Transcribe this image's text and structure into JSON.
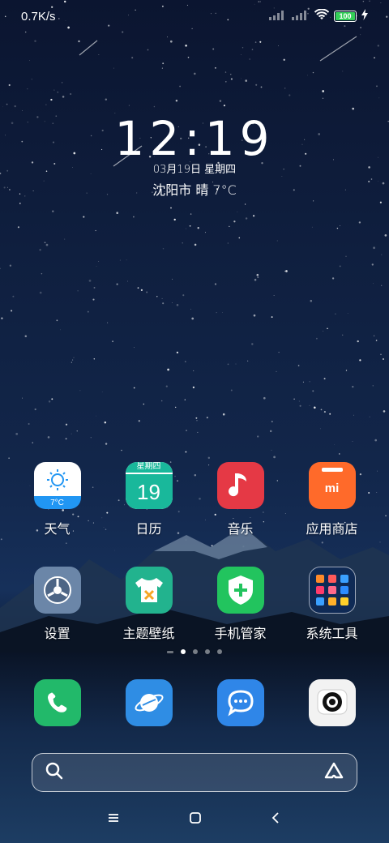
{
  "status_bar": {
    "network_speed": "0.7K/s",
    "battery_level": "100"
  },
  "clock": {
    "time": "12:19",
    "date": "03月19日 星期四",
    "weather": "沈阳市 晴 7°C"
  },
  "apps": {
    "row1": [
      {
        "label": "天气",
        "icon": "weather-icon",
        "sub": "7°C"
      },
      {
        "label": "日历",
        "icon": "calendar-icon",
        "weekday": "星期四",
        "day": "19"
      },
      {
        "label": "音乐",
        "icon": "music-icon"
      },
      {
        "label": "应用商店",
        "icon": "app-store-icon",
        "logo": "mi"
      }
    ],
    "row2": [
      {
        "label": "设置",
        "icon": "settings-icon"
      },
      {
        "label": "主题壁纸",
        "icon": "themes-icon"
      },
      {
        "label": "手机管家",
        "icon": "security-icon"
      },
      {
        "label": "系统工具",
        "icon": "tools-folder-icon"
      }
    ]
  },
  "page_indicator": {
    "pages": 4,
    "active": 1
  },
  "dock": [
    {
      "name": "phone",
      "icon": "phone-icon"
    },
    {
      "name": "browser",
      "icon": "browser-icon"
    },
    {
      "name": "messages",
      "icon": "messages-icon"
    },
    {
      "name": "camera",
      "icon": "camera-icon"
    }
  ],
  "search": {
    "placeholder": ""
  },
  "nav": {
    "menu": "menu-icon",
    "home": "home-icon",
    "back": "back-icon"
  },
  "colors": {
    "weather_top": "#ffffff",
    "weather_bottom": "#2196f3",
    "calendar": "#19b89b",
    "music": "#e53945",
    "app_store": "#ff6a2a",
    "settings": "#6b86a8",
    "themes": "#22b38e",
    "security": "#22c45e",
    "tools_folder": "#0f2a55",
    "phone": "#22b96a",
    "browser": "#2f8de4",
    "messages": "#2f86e8",
    "camera": "#f2f2f2"
  }
}
